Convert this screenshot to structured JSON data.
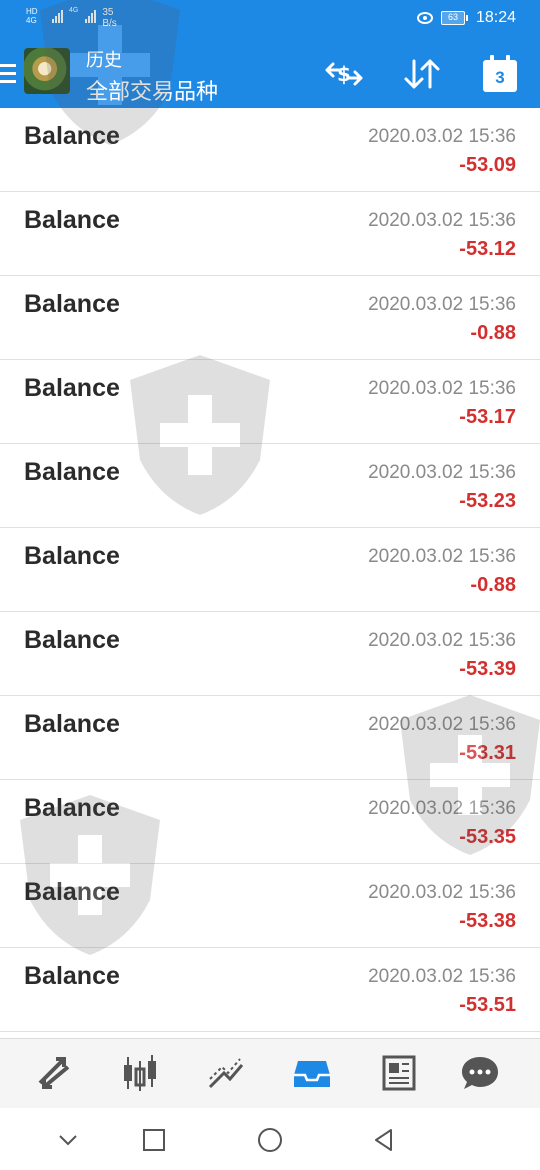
{
  "status_bar": {
    "sim1_label": "HD 4G",
    "sim2_label": "4G",
    "net_speed": "35",
    "net_speed_unit": "B/s",
    "battery": "63",
    "time": "18:24"
  },
  "header": {
    "title": "历史",
    "subtitle": "全部交易品种",
    "calendar_day": "3",
    "accent_color": "#1e88e5"
  },
  "records": [
    {
      "type": "Balance",
      "datetime": "2020.03.02 15:36",
      "amount": "-53.09"
    },
    {
      "type": "Balance",
      "datetime": "2020.03.02 15:36",
      "amount": "-53.12"
    },
    {
      "type": "Balance",
      "datetime": "2020.03.02 15:36",
      "amount": "-0.88"
    },
    {
      "type": "Balance",
      "datetime": "2020.03.02 15:36",
      "amount": "-53.17"
    },
    {
      "type": "Balance",
      "datetime": "2020.03.02 15:36",
      "amount": "-53.23"
    },
    {
      "type": "Balance",
      "datetime": "2020.03.02 15:36",
      "amount": "-0.88"
    },
    {
      "type": "Balance",
      "datetime": "2020.03.02 15:36",
      "amount": "-53.39"
    },
    {
      "type": "Balance",
      "datetime": "2020.03.02 15:36",
      "amount": "-53.31"
    },
    {
      "type": "Balance",
      "datetime": "2020.03.02 15:36",
      "amount": "-53.35"
    },
    {
      "type": "Balance",
      "datetime": "2020.03.02 15:36",
      "amount": "-53.38"
    },
    {
      "type": "Balance",
      "datetime": "2020.03.02 15:36",
      "amount": "-53.51"
    }
  ],
  "icons": {
    "header": [
      "menu-icon",
      "app-logo",
      "currency-exchange-icon",
      "sort-icon",
      "calendar-icon"
    ],
    "tabs": [
      "quotes-icon",
      "chart-icon",
      "trade-icon",
      "history-icon",
      "news-icon",
      "chat-icon"
    ],
    "nav": [
      "collapse-icon",
      "recents-icon",
      "home-icon",
      "back-icon"
    ]
  },
  "active_tab": "history",
  "colors": {
    "negative_amount": "#d32f2f",
    "active_tab": "#1e88e5",
    "inactive_tab": "#555555"
  }
}
